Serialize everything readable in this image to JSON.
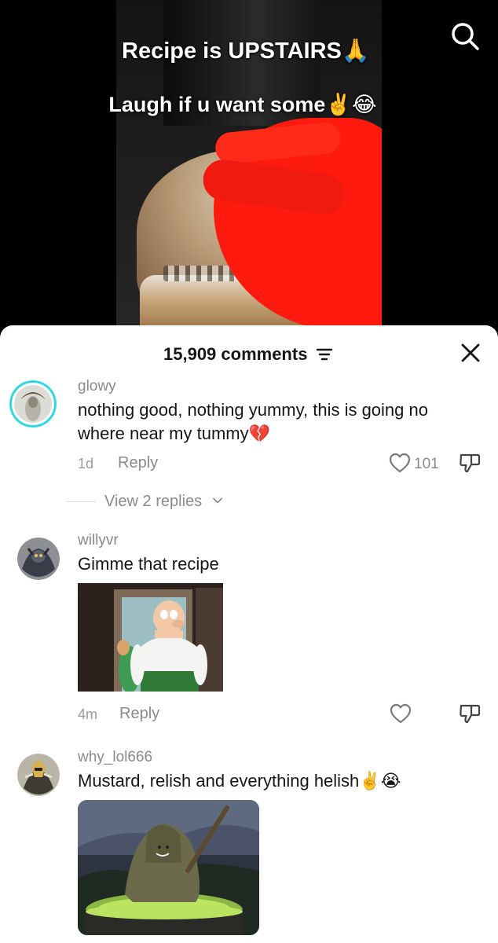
{
  "video": {
    "overlay_line1": "Recipe is UPSTAIRS🙏",
    "overlay_line2": "Laugh if u want some✌️😂"
  },
  "sheet": {
    "comment_count_label": "15,909 comments"
  },
  "comments": [
    {
      "username": "glowy",
      "text": "nothing good, nothing yummy, this is going no where near my tummy💔",
      "time": "1d",
      "reply_label": "Reply",
      "likes": "101",
      "view_replies": "View 2 replies"
    },
    {
      "username": "willyvr",
      "text": "Gimme that recipe",
      "time": "4m",
      "reply_label": "Reply"
    },
    {
      "username": "why_lol666",
      "text": "Mustard, relish and everything helish✌️😭"
    }
  ],
  "icons": {
    "search": "search-icon",
    "filter": "filter-icon",
    "close": "close-icon",
    "like": "heart-icon",
    "dislike": "thumbs-down-icon",
    "chevron": "chevron-down-icon"
  },
  "colors": {
    "username": "#8a8a8a",
    "text": "#161616",
    "avatar_ring": "#2bd9e6"
  }
}
